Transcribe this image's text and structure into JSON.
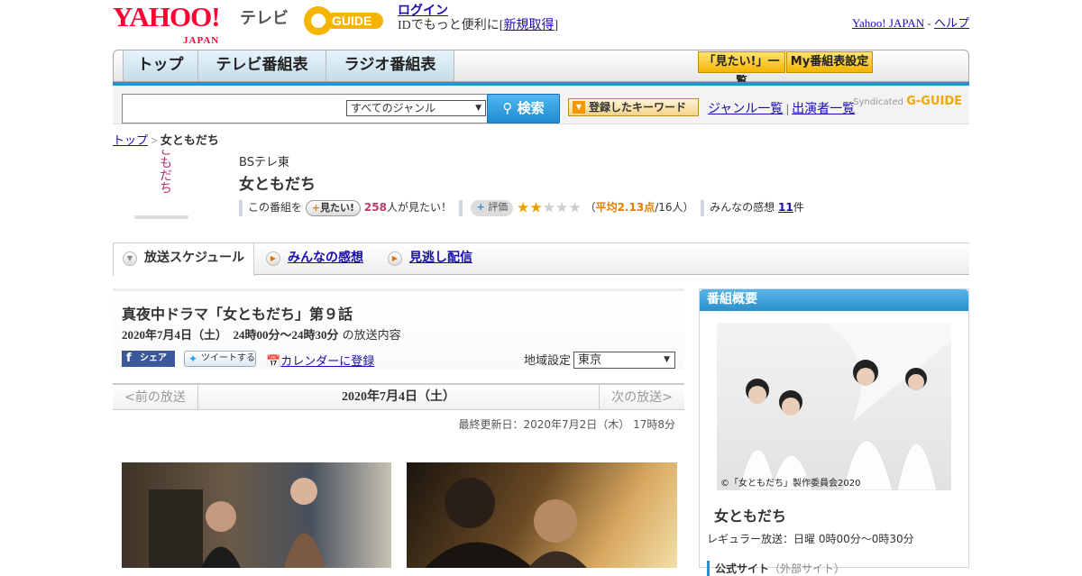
{
  "header": {
    "logo_text": "YAHOO!",
    "logo_sub": "JAPAN",
    "tv_label": "テレビ",
    "gguide_logo": "G-GUIDE",
    "login_link": "ログイン",
    "login_prompt": "IDでもっと便利に[",
    "register_link": "新規取得",
    "login_prompt_end": "]",
    "yahoo_link": "Yahoo! JAPAN",
    "dash": " - ",
    "help_link": "ヘルプ"
  },
  "nav": {
    "tabs": [
      {
        "label": "トップ"
      },
      {
        "label": "テレビ番組表"
      },
      {
        "label": "ラジオ番組表"
      }
    ],
    "mitai_list": "「見たい!」一覧",
    "my_settings": "My番組表設定"
  },
  "search": {
    "genre_selected": "すべてのジャンル",
    "search_button": "検索",
    "keyword_button": "登録したキーワード",
    "genre_list_link": "ジャンル一覧",
    "divider": "|",
    "cast_list_link": "出演者一覧",
    "syndicated": "Syndicated",
    "syndicated_logo": "G-GUIDE"
  },
  "breadcrumb": {
    "top": "トップ",
    "sep": ">",
    "current": "女ともだち"
  },
  "program": {
    "thumb_text": "女ともだち",
    "channel": "BSテレ東",
    "title": "女ともだち",
    "mitai_prefix": "この番組を",
    "mitai_button": "見たい!",
    "mitai_count": "258",
    "mitai_suffix": "人が見たい！",
    "hyoka_button": "評価",
    "rating": 2.13,
    "stars_filled": 2,
    "stars_total": 5,
    "avg_prefix": "（",
    "avg_text": "平均2.13点",
    "avg_suffix": "/16人）",
    "impressions_prefix": "みんなの感想",
    "impressions_count": "11",
    "impressions_suffix": "件"
  },
  "subtabs": [
    {
      "label": "放送スケジュール"
    },
    {
      "label": "みんなの感想"
    },
    {
      "label": "見逃し配信"
    }
  ],
  "episode": {
    "title": "真夜中ドラマ「女ともだち」第９話",
    "date": "2020年7月4日（土）　24時00分～24時30分",
    "date_suffix": "の放送内容",
    "share_fb": "シェア",
    "tweet": "ツイートする",
    "calendar_link": "カレンダーに登録",
    "region_label": "地域設定",
    "region_selected": "東京"
  },
  "date_nav": {
    "prev": "<前の放送",
    "current": "2020年7月4日（土）",
    "next": "次の放送>"
  },
  "updated": "最終更新日：2020年7月2日（木）  17時8分",
  "sidebar": {
    "heading": "番組概要",
    "photo_credit": "©「女ともだち」製作委員会2020",
    "title": "女ともだち",
    "regular": "レギュラー放送：日曜 0時00分～0時30分",
    "official_site": "公式サイト",
    "official_note": "（外部サイト）"
  },
  "colors": {
    "accent_blue": "#2c91cd",
    "yahoo_red": "#ff0033",
    "star_gold": "#e8a200",
    "link": "#1a0dab"
  }
}
